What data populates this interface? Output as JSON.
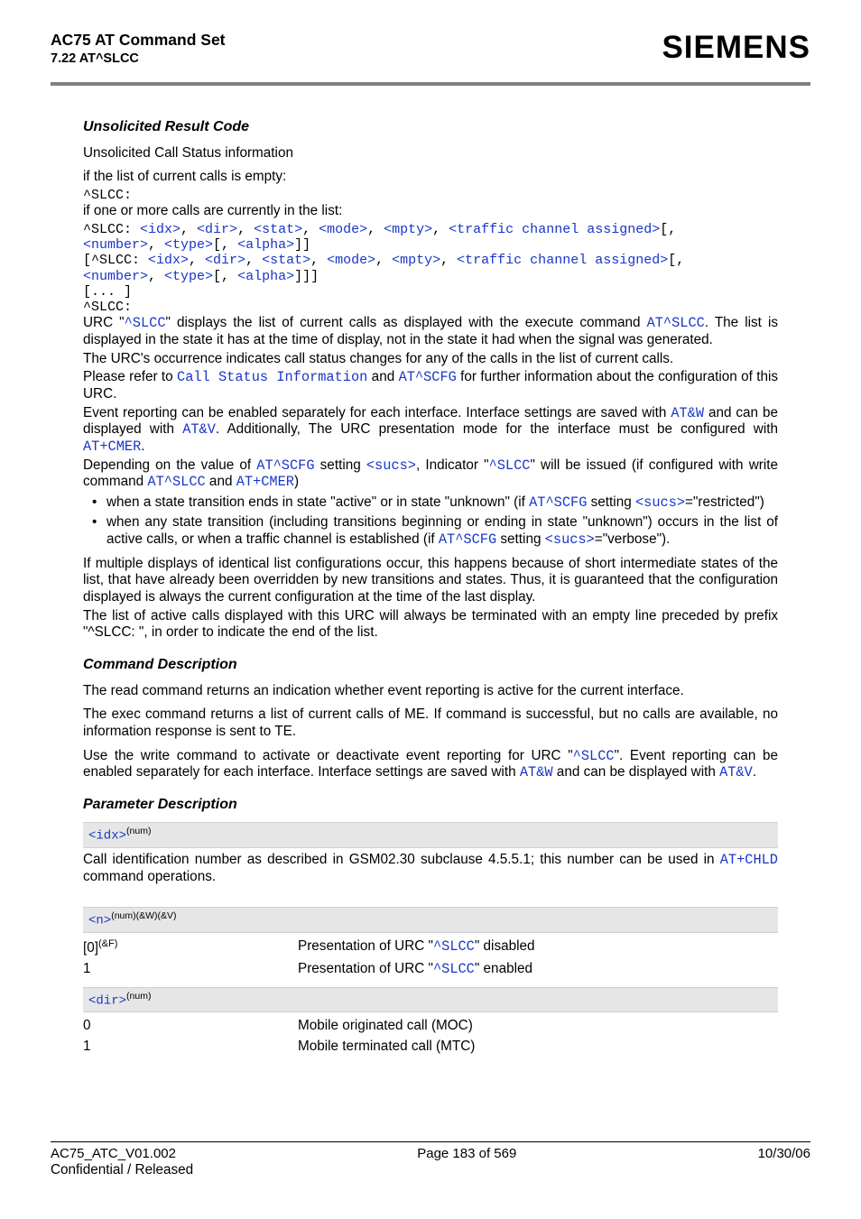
{
  "header": {
    "title": "AC75 AT Command Set",
    "subtitle": "7.22 AT^SLCC",
    "logo": "SIEMENS"
  },
  "urc": {
    "heading": "Unsolicited Result Code",
    "intro": "Unsolicited Call Status information",
    "if_empty_label": "if the list of current calls is empty:",
    "if_empty_code": "^SLCC:",
    "if_calls_label": "if one or more calls are currently in the list:",
    "code_line1_pre": "^SLCC: ",
    "code_line1_links": [
      "<idx>",
      "<dir>",
      "<stat>",
      "<mode>",
      "<mpty>",
      "<traffic channel assigned>"
    ],
    "code_line1_brk": "[, ",
    "code_line2_links": [
      "<number>",
      "<type>"
    ],
    "code_line2_brk1": "[, ",
    "code_line2_links2": [
      "<alpha>"
    ],
    "code_line2_end": "]]",
    "code_line3_pre": "[^SLCC: ",
    "code_line3_end": "[, ",
    "code_line4_end": "]]]",
    "code_ellipsis": "[... ]",
    "code_final": "^SLCC:",
    "des1a": "URC \"",
    "des1_link1": "^SLCC",
    "des1b": "\" displays the list of current calls as displayed with the execute command ",
    "des1_link2": "AT^SLCC",
    "des1c": ". The list is displayed in the state it has at the time of display, not in the state it had when the signal was generated.",
    "des2": "The URC's occurrence indicates call status changes for any of the calls in the list of current calls.",
    "des3a": "Please refer to ",
    "des3_link1": "Call Status Information",
    "des3b": " and ",
    "des3_link2": "AT^SCFG",
    "des3c": " for further information about the configuration of this URC.",
    "des4a": "Event reporting can be enabled separately for each interface. Interface settings are saved with ",
    "des4_link1": "AT&W",
    "des4b": " and can be displayed with ",
    "des4_link2": "AT&V",
    "des4c": ". Additionally, The URC presentation mode for the interface must be configured with ",
    "des4_link3": "AT+CMER",
    "des4d": ".",
    "des5a": "Depending on the value of ",
    "des5_link1": "AT^SCFG",
    "des5b": " setting ",
    "des5_link2": "<sucs>",
    "des5c": ", Indicator \"",
    "des5_link3": "^SLCC",
    "des5d": "\" will be issued (if configured with write command ",
    "des5_link4": "AT^SLCC",
    "des5e": " and ",
    "des5_link5": "AT+CMER",
    "des5f": ")",
    "bullet1a": "when a state transition ends in state \"active\" or in state \"unknown\" (if ",
    "bullet1_link1": "AT^SCFG",
    "bullet1b": " setting ",
    "bullet1_link2": "<sucs>",
    "bullet1c": "=\"restricted\")",
    "bullet2a": "when any state transition (including transitions beginning or ending in state \"unknown\") occurs in the list of active calls, or when a traffic channel is established (if ",
    "bullet2_link1": "AT^SCFG",
    "bullet2b": " setting ",
    "bullet2_link2": "<sucs>",
    "bullet2c": "=\"verbose\").",
    "closing1": "If multiple displays of identical list configurations occur, this happens because of short intermediate states of the list, that have already been overridden by new transitions and states. Thus, it is guaranteed that the configuration displayed is always the current configuration at the time of the last display.",
    "closing2": "The list of active calls displayed with this URC will always be terminated with an empty line preceded by prefix \"^SLCC: \", in order to indicate the end of the list."
  },
  "cmd": {
    "heading": "Command Description",
    "p1": "The read command returns an indication whether event reporting is active for the current interface.",
    "p2": "The exec command returns a list of current calls of ME. If command is successful, but no calls are available, no information response is sent to TE.",
    "p3a": "Use the write command to activate or deactivate event reporting for URC \"",
    "p3_link1": "^SLCC",
    "p3b": "\". Event reporting can be enabled separately for each interface. Interface settings are saved with ",
    "p3_link2": "AT&W",
    "p3c": " and can be displayed with ",
    "p3_link3": "AT&V",
    "p3d": "."
  },
  "params": {
    "heading": "Parameter Description",
    "idx_name": "<idx>",
    "idx_sup": "(num)",
    "idx_desc_a": "Call identification number as described in GSM02.30 subclause 4.5.5.1; this number can be used in ",
    "idx_link": "AT+CHLD",
    "idx_desc_b": " command operations.",
    "n_name": "<n>",
    "n_sup": "(num)(&W)(&V)",
    "n_row0_key": "[0]",
    "n_row0_sup": "(&F)",
    "n_row0_a": "Presentation of URC \"",
    "n_row0_link": "^SLCC",
    "n_row0_b": "\" disabled",
    "n_row1_key": "1",
    "n_row1_a": "Presentation of URC \"",
    "n_row1_link": "^SLCC",
    "n_row1_b": "\" enabled",
    "dir_name": "<dir>",
    "dir_sup": "(num)",
    "dir_row0_key": "0",
    "dir_row0_val": "Mobile originated call (MOC)",
    "dir_row1_key": "1",
    "dir_row1_val": "Mobile terminated call (MTC)"
  },
  "footer": {
    "left1": "AC75_ATC_V01.002",
    "center": "Page 183 of 569",
    "right": "10/30/06",
    "left2": "Confidential / Released"
  }
}
